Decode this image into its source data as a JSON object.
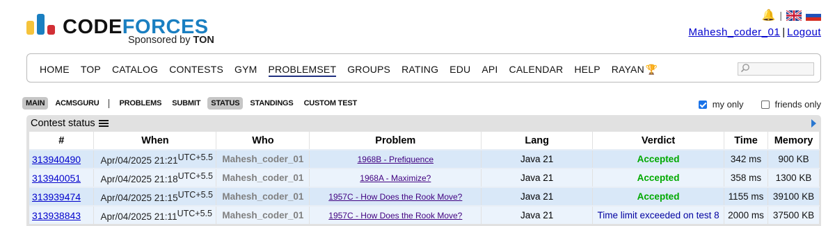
{
  "brand": {
    "code": "CODE",
    "forces": "FORCES",
    "sponsored_prefix": "Sponsored by",
    "sponsor": "TON"
  },
  "header": {
    "separator": "|",
    "username": "Mahesh_coder_01",
    "logout": "Logout"
  },
  "nav": {
    "items": [
      "HOME",
      "TOP",
      "CATALOG",
      "CONTESTS",
      "GYM",
      "PROBLEMSET",
      "GROUPS",
      "RATING",
      "EDU",
      "API",
      "CALENDAR",
      "HELP",
      "RAYAN"
    ],
    "active": "PROBLEMSET",
    "search_value": ""
  },
  "subnav": {
    "items": [
      "MAIN",
      "ACMSGURU",
      "PROBLEMS",
      "SUBMIT",
      "STATUS",
      "STANDINGS",
      "CUSTOM TEST"
    ],
    "selected": [
      "MAIN",
      "STATUS"
    ]
  },
  "filters": {
    "my_only": "my only",
    "friends_only": "friends only",
    "my_only_checked": true,
    "friends_only_checked": false
  },
  "panel": {
    "title": "Contest status"
  },
  "table": {
    "headers": [
      "#",
      "When",
      "Who",
      "Problem",
      "Lang",
      "Verdict",
      "Time",
      "Memory"
    ],
    "rows": [
      {
        "id": "313940490",
        "when": "Apr/04/2025 21:21",
        "tz": "UTC+5.5",
        "who": "Mahesh_coder_01",
        "problem": "1968B - Prefiquence",
        "lang": "Java 21",
        "verdict": "Accepted",
        "time": "342 ms",
        "memory": "900 KB"
      },
      {
        "id": "313940051",
        "when": "Apr/04/2025 21:18",
        "tz": "UTC+5.5",
        "who": "Mahesh_coder_01",
        "problem": "1968A - Maximize?",
        "lang": "Java 21",
        "verdict": "Accepted",
        "time": "358 ms",
        "memory": "1300 KB"
      },
      {
        "id": "313939474",
        "when": "Apr/04/2025 21:15",
        "tz": "UTC+5.5",
        "who": "Mahesh_coder_01",
        "problem": "1957C - How Does the Rook Move?",
        "lang": "Java 21",
        "verdict": "Accepted",
        "time": "1155 ms",
        "memory": "39100 KB"
      },
      {
        "id": "313938843",
        "when": "Apr/04/2025 21:11",
        "tz": "UTC+5.5",
        "who": "Mahesh_coder_01",
        "problem": "1957C - How Does the Rook Move?",
        "lang": "Java 21",
        "verdict": "Time limit exceeded on test 8",
        "time": "2000 ms",
        "memory": "37500 KB"
      }
    ]
  },
  "colors": {
    "accent": "#1a7fc1",
    "accepted": "#00a900",
    "rejected": "#0000a0",
    "link": "#0000cc"
  }
}
